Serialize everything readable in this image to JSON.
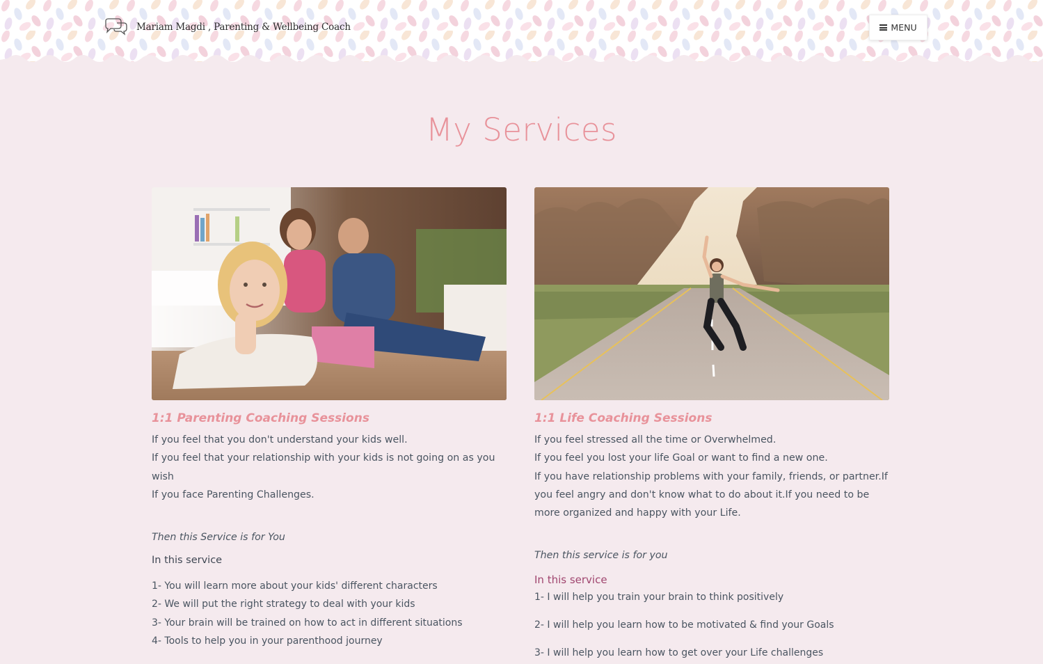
{
  "header": {
    "brand_title": "Mariam Magdi , Parenting & Wellbeing Coach",
    "menu_label": "MENU"
  },
  "main": {
    "title": "My Services",
    "cards": [
      {
        "title": "1:1 Parenting Coaching Sessions",
        "intro": [
          "If you feel that you don't understand your kids well.",
          "If you feel that your relationship with your kids is not going on as you wish",
          "If you face Parenting Challenges."
        ],
        "then": "Then this Service is for You",
        "in_service": "In this service",
        "items": [
          "1- You will learn more about your kids' different characters",
          "2- We will put the right strategy to deal with your kids",
          "3- Your brain will be trained on how to act in different situations",
          "4- Tools to help you in your parenthood journey"
        ]
      },
      {
        "title": "1:1 Life Coaching Sessions",
        "intro": [
          "If you feel stressed all the time or Overwhelmed.",
          "If you feel you lost your life Goal or want to find a new one.",
          "If you have relationship problems with your family, friends, or partner.If you feel angry and don't know what to do about it.If you need to be more organized and happy with your Life."
        ],
        "then": "Then this service is for you",
        "in_service": "In this service",
        "items": [
          "1- I will help you train your brain to think positively",
          "2- I will help you learn how to be motivated & find your Goals",
          "3- I will help you learn how to get over your Life challenges"
        ]
      }
    ]
  },
  "colors": {
    "accent": "#e8929a",
    "page_bg": "#f5eaee",
    "body_text": "#4a5561",
    "highlight": "#a0466f"
  },
  "icons": {
    "brand": "speech-bubbles-icon",
    "menu": "hamburger-icon"
  }
}
